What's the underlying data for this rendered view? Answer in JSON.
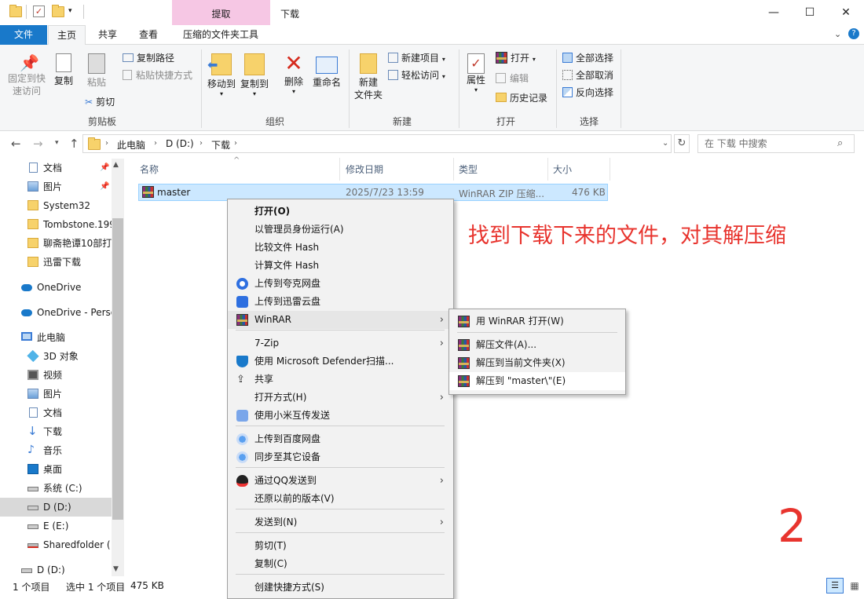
{
  "window": {
    "context_tab": "提取",
    "title": "下载",
    "minimize": "—",
    "maximize": "☐",
    "close": "✕"
  },
  "ribbon_tabs": {
    "file": "文件",
    "home": "主页",
    "share": "共享",
    "view": "查看",
    "compressed_tools": "压缩的文件夹工具"
  },
  "ribbon": {
    "clipboard": {
      "pin": "固定到快\n速访问",
      "copy": "复制",
      "paste": "粘贴",
      "copy_path": "复制路径",
      "paste_shortcut": "粘贴快捷方式",
      "cut": "剪切",
      "group": "剪贴板"
    },
    "organize": {
      "move_to": "移动到",
      "copy_to": "复制到",
      "delete": "删除",
      "rename": "重命名",
      "group": "组织"
    },
    "new": {
      "new_folder": "新建\n文件夹",
      "new_item": "新建项目",
      "easy_access": "轻松访问",
      "group": "新建"
    },
    "open": {
      "properties": "属性",
      "open": "打开",
      "edit": "编辑",
      "history": "历史记录",
      "group": "打开"
    },
    "select": {
      "select_all": "全部选择",
      "select_none": "全部取消",
      "invert": "反向选择",
      "group": "选择"
    }
  },
  "address": {
    "crumbs": [
      "此电脑",
      "D (D:)",
      "下载"
    ],
    "search_placeholder": "在 下载 中搜索"
  },
  "nav": {
    "items": [
      "文档",
      "图片",
      "System32",
      "Tombstone.199",
      "聊斋艳谭10部打",
      "迅雷下载",
      "OneDrive",
      "OneDrive - Perso",
      "此电脑",
      "3D 对象",
      "视频",
      "图片",
      "文档",
      "下载",
      "音乐",
      "桌面",
      "系统 (C:)",
      "D (D:)",
      "E (E:)",
      "Sharedfolder (",
      "D (D:)"
    ]
  },
  "columns": {
    "name": "名称",
    "modified": "修改日期",
    "type": "类型",
    "size": "大小"
  },
  "files": [
    {
      "name": "master",
      "modified": "2025/7/23 13:59",
      "type": "WinRAR ZIP 压缩...",
      "size": "476 KB"
    }
  ],
  "status": {
    "count": "1 个项目",
    "selected": "选中 1 个项目",
    "size": "475 KB"
  },
  "context_menu": {
    "items": [
      "打开(O)",
      "以管理员身份运行(A)",
      "比较文件 Hash",
      "计算文件 Hash",
      "上传到夸克网盘",
      "上传到迅雷云盘",
      "WinRAR",
      "7-Zip",
      "使用 Microsoft Defender扫描...",
      "共享",
      "打开方式(H)",
      "使用小米互传发送",
      "上传到百度网盘",
      "同步至其它设备",
      "通过QQ发送到",
      "还原以前的版本(V)",
      "发送到(N)",
      "剪切(T)",
      "复制(C)",
      "创建快捷方式(S)"
    ]
  },
  "winrar_submenu": {
    "items": [
      "用 WinRAR 打开(W)",
      "解压文件(A)...",
      "解压到当前文件夹(X)",
      "解压到 \"master\\\"(E)"
    ]
  },
  "annotation": {
    "text": "找到下载下来的文件，对其解压缩",
    "step": "2"
  }
}
